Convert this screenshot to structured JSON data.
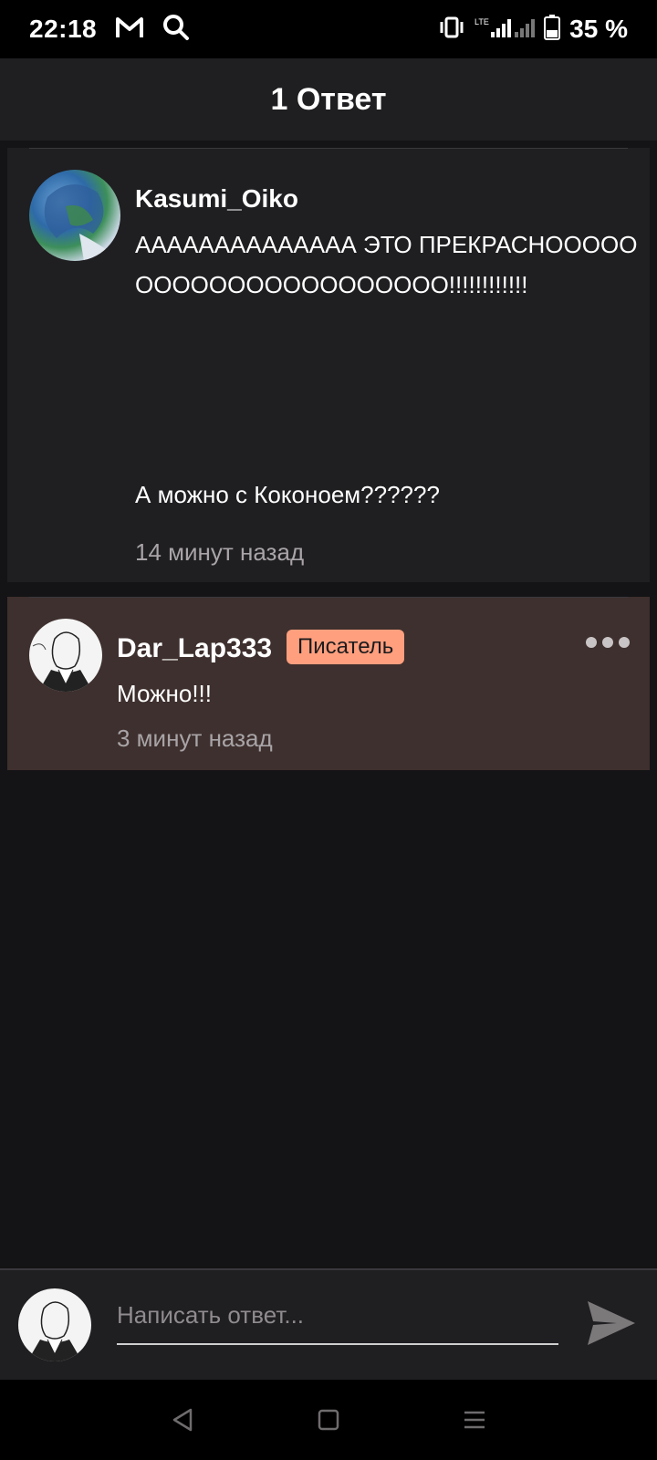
{
  "status_bar": {
    "time": "22:18",
    "network": "LTE",
    "battery": "35 %",
    "icons": [
      "gmail-icon",
      "search-icon",
      "vibrate-icon",
      "signal-icon",
      "battery-icon"
    ]
  },
  "header": {
    "title": "1 Ответ"
  },
  "parent_comment": {
    "username": "Kasumi_Oiko",
    "lines": [
      "АААААААААААААА ЭТО ПРЕКРАСНООООО",
      "ООООООООООООООООО!!!!!!!!!!!!",
      "А можно с Коконоем??????"
    ],
    "timestamp": "14 минут назад"
  },
  "reply": {
    "username": "Dar_Lap333",
    "badge": "Писатель",
    "text": "Можно!!!",
    "timestamp": "3 минут назад"
  },
  "composer": {
    "placeholder": "Написать ответ..."
  },
  "colors": {
    "background": "#141315",
    "card": "#1f1e21",
    "reply_card": "#3e302e",
    "badge": "#ff9f7e"
  }
}
